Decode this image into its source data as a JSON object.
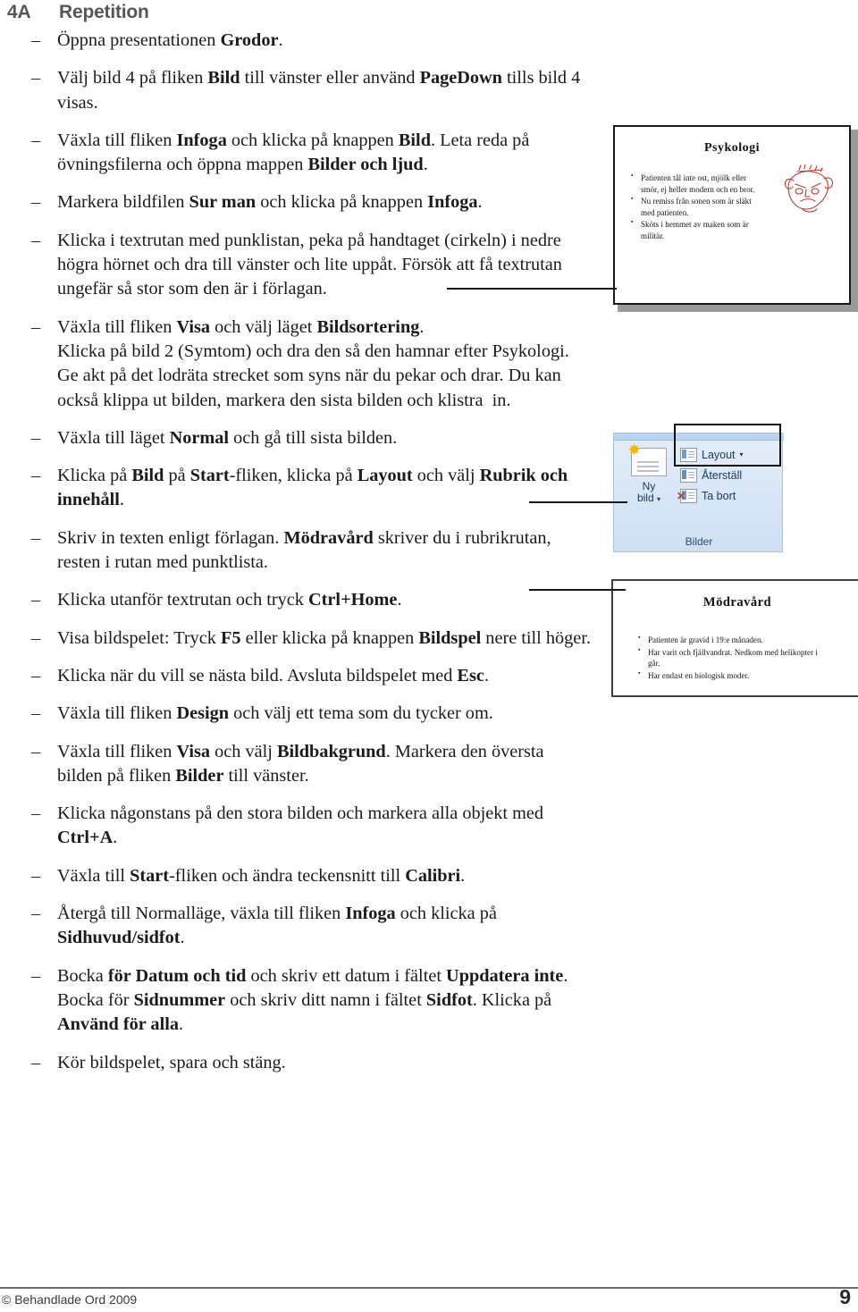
{
  "header": {
    "number": "4A",
    "title": "Repetition"
  },
  "steps": [
    {
      "dash": "–",
      "html": "Öppna presentationen <b>Grodor</b>."
    },
    {
      "dash": "–",
      "html": "Välj bild 4 på fliken <b>Bild</b> till vänster eller använd <b>PageDown</b> tills bild 4 visas."
    },
    {
      "dash": "–",
      "html": "Växla till fliken <b>Infoga</b> och klicka på knappen <b>Bild</b>. Leta reda på övningsfilerna och öppna mappen <b>Bilder och ljud</b>."
    },
    {
      "dash": "–",
      "html": "Markera bildfilen <b>Sur man</b> och klicka på knappen <b>Infoga</b>."
    },
    {
      "dash": "–",
      "html": "Klicka i textrutan med punklistan, peka på handtaget (cirkeln) i nedre högra hörnet och dra till vänster och lite uppåt. Försök att få textrutan ungefär så stor som den är i förlagan."
    },
    {
      "dash": "–",
      "html": "Växla till fliken <b>Visa</b> och välj läget <b>Bildsortering</b>.<br>Klicka på bild 2 (Symtom) och dra den så den hamnar efter Psykologi. Ge akt på det lodräta strecket som syns när du pekar och drar. Du kan också klippa ut bilden, markera den sista bilden och klistra&nbsp; in."
    },
    {
      "dash": "–",
      "html": "Växla till läget <b>Normal</b> och gå till sista bilden."
    },
    {
      "dash": "–",
      "html": "Klicka på <b>Bild</b> på <b>Start</b>-fliken, klicka på <b>Layout</b> och välj <b>Rubrik och innehåll</b>."
    },
    {
      "dash": "–",
      "html": "Skriv in texten enligt förlagan. <b>Mödravård</b> skriver du i rubrikrutan, resten i rutan med punktlista."
    },
    {
      "dash": "–",
      "html": "Klicka utanför textrutan och tryck <b>Ctrl+Home</b>."
    },
    {
      "dash": "–",
      "html": "Visa bildspelet: Tryck <b>F5</b> eller klicka på knappen <b>Bildspel</b> nere till höger."
    },
    {
      "dash": "–",
      "html": "Klicka när du vill se nästa bild. Avsluta bildspelet med <b>Esc</b>."
    },
    {
      "dash": "–",
      "html": "Växla till fliken <b>Design</b> och välj ett tema som du tycker om."
    },
    {
      "dash": "–",
      "html": "Växla till fliken <b>Visa</b> och välj <b>Bildbakgrund</b>. Markera den översta bilden på fliken <b>Bilder</b> till vänster."
    },
    {
      "dash": "–",
      "html": "Klicka någonstans på den stora bilden och markera alla objekt med <b>Ctrl+A</b>."
    },
    {
      "dash": "–",
      "html": "Växla till <b>Start</b>-fliken och ändra teckensnitt till <b>Calibri</b>."
    },
    {
      "dash": "–",
      "html": "Återgå till Normalläge, växla till fliken <b>Infoga</b> och klicka på <b>Sidhuvud/sidfot</b>."
    },
    {
      "dash": "–",
      "html": "Bocka <b>för Datum och tid</b> och skriv ett datum i fältet <b>Uppdatera inte</b>. Bocka för <b>Sidnummer</b> och skriv ditt namn i fältet <b>Sidfot</b>. Klicka på <b>Använd för alla</b>."
    },
    {
      "dash": "–",
      "html": "Kör bildspelet, spara och stäng."
    }
  ],
  "figures": {
    "slide_psykologi": {
      "title": "Psykologi",
      "bullets": [
        "Patienten tål inte ost, mjölk eller smör, ej heller modern och en bror.",
        "Nu remiss från sonen som är släkt med patienten.",
        "Sköts i hemmet av maken som är militär."
      ],
      "clipart": "angry-face-drawing",
      "clipart_color": "#c0392b"
    },
    "ribbon": {
      "new_slide_label": "Ny",
      "new_slide_label2": "bild",
      "caret": "▾",
      "commands": [
        {
          "label": "Layout",
          "caret": "▾"
        },
        {
          "label": "Återställ",
          "caret": ""
        },
        {
          "label": "Ta bort",
          "caret": ""
        }
      ],
      "group_label": "Bilder",
      "star_icon": "✸"
    },
    "slide_modravard": {
      "title": "Mödravård",
      "bullets": [
        "Patienten är gravid i 19:e månaden.",
        "Har varit och fjällvandrat. Nedkom med helikopter i går.",
        "Har endast en biologisk moder."
      ]
    }
  },
  "footer": {
    "copyright": "© Behandlade Ord 2009",
    "page_number": "9"
  }
}
